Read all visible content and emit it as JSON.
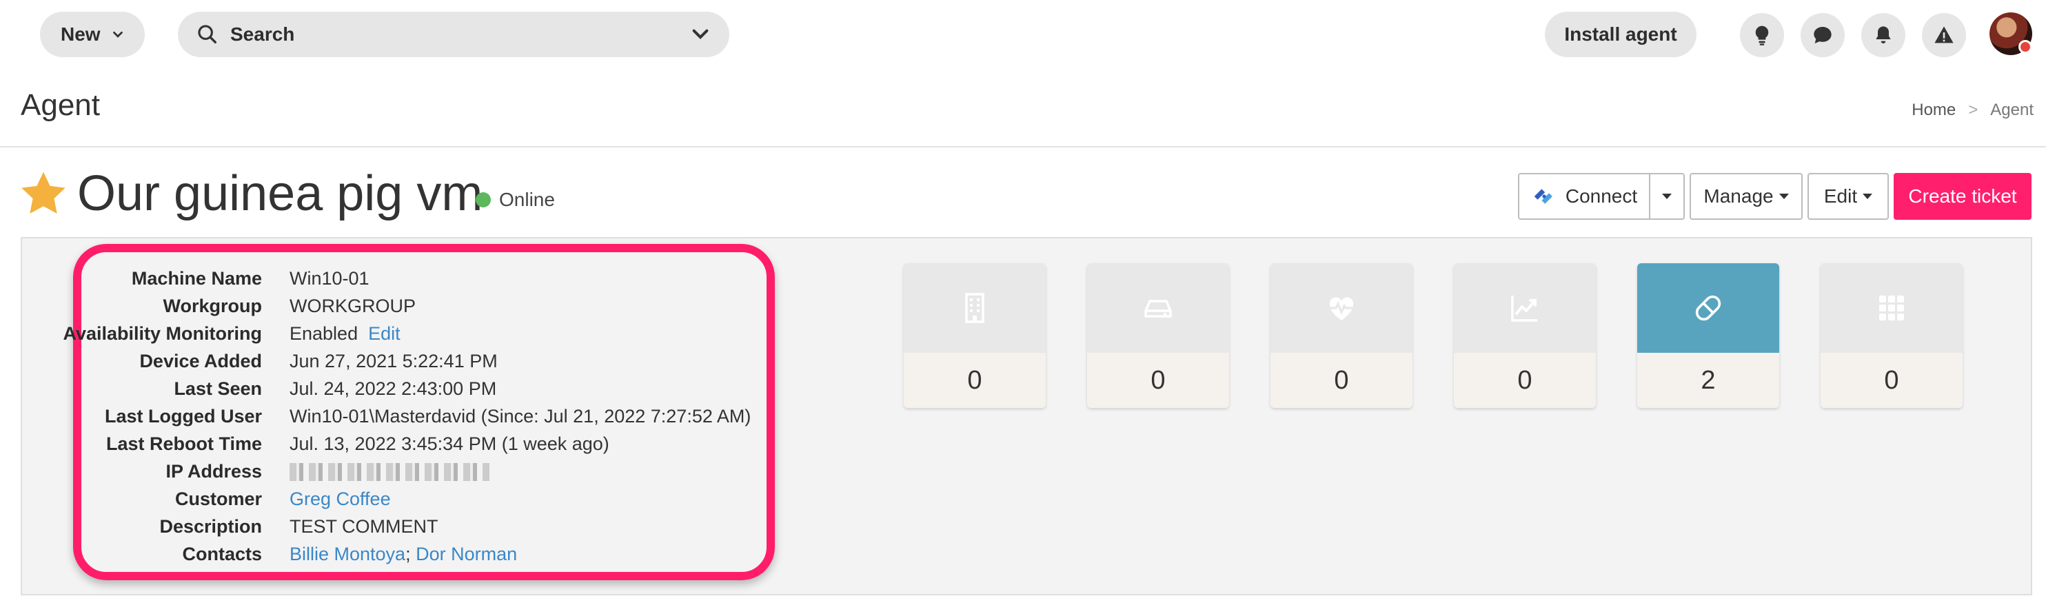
{
  "topbar": {
    "new_label": "New",
    "search_label": "Search",
    "install_label": "Install agent",
    "icons": [
      "lightbulb-icon",
      "chat-icon",
      "bell-icon",
      "alert-icon"
    ],
    "accent": "#ff1f6d"
  },
  "page": {
    "title": "Agent",
    "breadcrumb": {
      "home": "Home",
      "separator": ">",
      "current": "Agent"
    }
  },
  "agent": {
    "name": "Our guinea pig vm",
    "status": "Online",
    "status_color": "#5cb85c"
  },
  "actions": {
    "connect": "Connect",
    "manage": "Manage",
    "edit": "Edit",
    "create_ticket": "Create ticket"
  },
  "details": [
    {
      "label": "Machine Name",
      "value": "Win10-01"
    },
    {
      "label": "Workgroup",
      "value": "WORKGROUP"
    },
    {
      "label": "Availability Monitoring",
      "value": "Enabled",
      "link": "Edit"
    },
    {
      "label": "Device Added",
      "value": "Jun 27, 2021 5:22:41 PM"
    },
    {
      "label": "Last Seen",
      "value": "Jul. 24, 2022 2:43:00 PM"
    },
    {
      "label": "Last Logged User",
      "value": "Win10-01\\Masterdavid (Since: Jul 21, 2022 7:27:52 AM)"
    },
    {
      "label": "Last Reboot Time",
      "value": "Jul. 13, 2022 3:45:34 PM (1 week ago)"
    },
    {
      "label": "IP Address",
      "value": ""
    },
    {
      "label": "Customer",
      "value": "Greg Coffee"
    },
    {
      "label": "Description",
      "value": "TEST COMMENT"
    },
    {
      "label": "Contacts",
      "contact1": "Billie Montoya",
      "sep": ";",
      "contact2": "Dor Norman"
    }
  ],
  "tiles": [
    {
      "icon": "building-icon",
      "count": "0"
    },
    {
      "icon": "drive-icon",
      "count": "0"
    },
    {
      "icon": "heartbeat-icon",
      "count": "0"
    },
    {
      "icon": "chart-line-icon",
      "count": "0"
    },
    {
      "icon": "pill-icon",
      "count": "2",
      "active": true,
      "color": "#58a4bf"
    },
    {
      "icon": "grid-icon",
      "count": "0"
    }
  ]
}
